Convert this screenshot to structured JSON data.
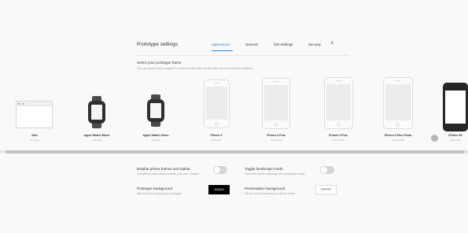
{
  "panel": {
    "title": "Prototype settings",
    "tabs": [
      "Appearance",
      "General",
      "iOS Settings",
      "Security"
    ],
    "active_tab": "Appearance",
    "close_icon": "×"
  },
  "select_frame": {
    "title": "Select your prototype frame",
    "description": "You can present your designs in device frames when people view them on desktop browsers."
  },
  "devices": [
    {
      "name": "Web",
      "dims": "No frame"
    },
    {
      "name": "Apple Watch 38mm",
      "dims": "272x340"
    },
    {
      "name": "Apple Watch 42mm",
      "dims": "312x390"
    },
    {
      "name": "iPhone 6",
      "dims": "750x1334"
    },
    {
      "name": "iPhone 6 Plus",
      "dims": "1242x2208"
    },
    {
      "name": "iPhone 6 Plus",
      "dims": "1242x2208"
    },
    {
      "name": "iPhone 6 Plus Photo",
      "dims": "1242x2208"
    },
    {
      "name": "iPhone 5S",
      "dims": "640x1136"
    }
  ],
  "options": {
    "disable_frames": {
      "title": "Disable phone frames and topbar",
      "desc": "Completely hides phone frames, just your images.",
      "enabled": false
    },
    "landscape": {
      "title": "Toggle landscape mode",
      "desc": "Turns the device sideways into landscape mode.",
      "enabled": false
    },
    "proto_bg": {
      "title": "Prototype background",
      "desc": "Set the colour inside your prototype.",
      "value": "000000"
    },
    "pres_bg": {
      "title": "Presentation background",
      "desc": "Set the colour around your device frame.",
      "value": "FFFFFF"
    }
  },
  "colors": {
    "accent": "#2e82d3",
    "toggle_off": "#d6d6d6"
  }
}
